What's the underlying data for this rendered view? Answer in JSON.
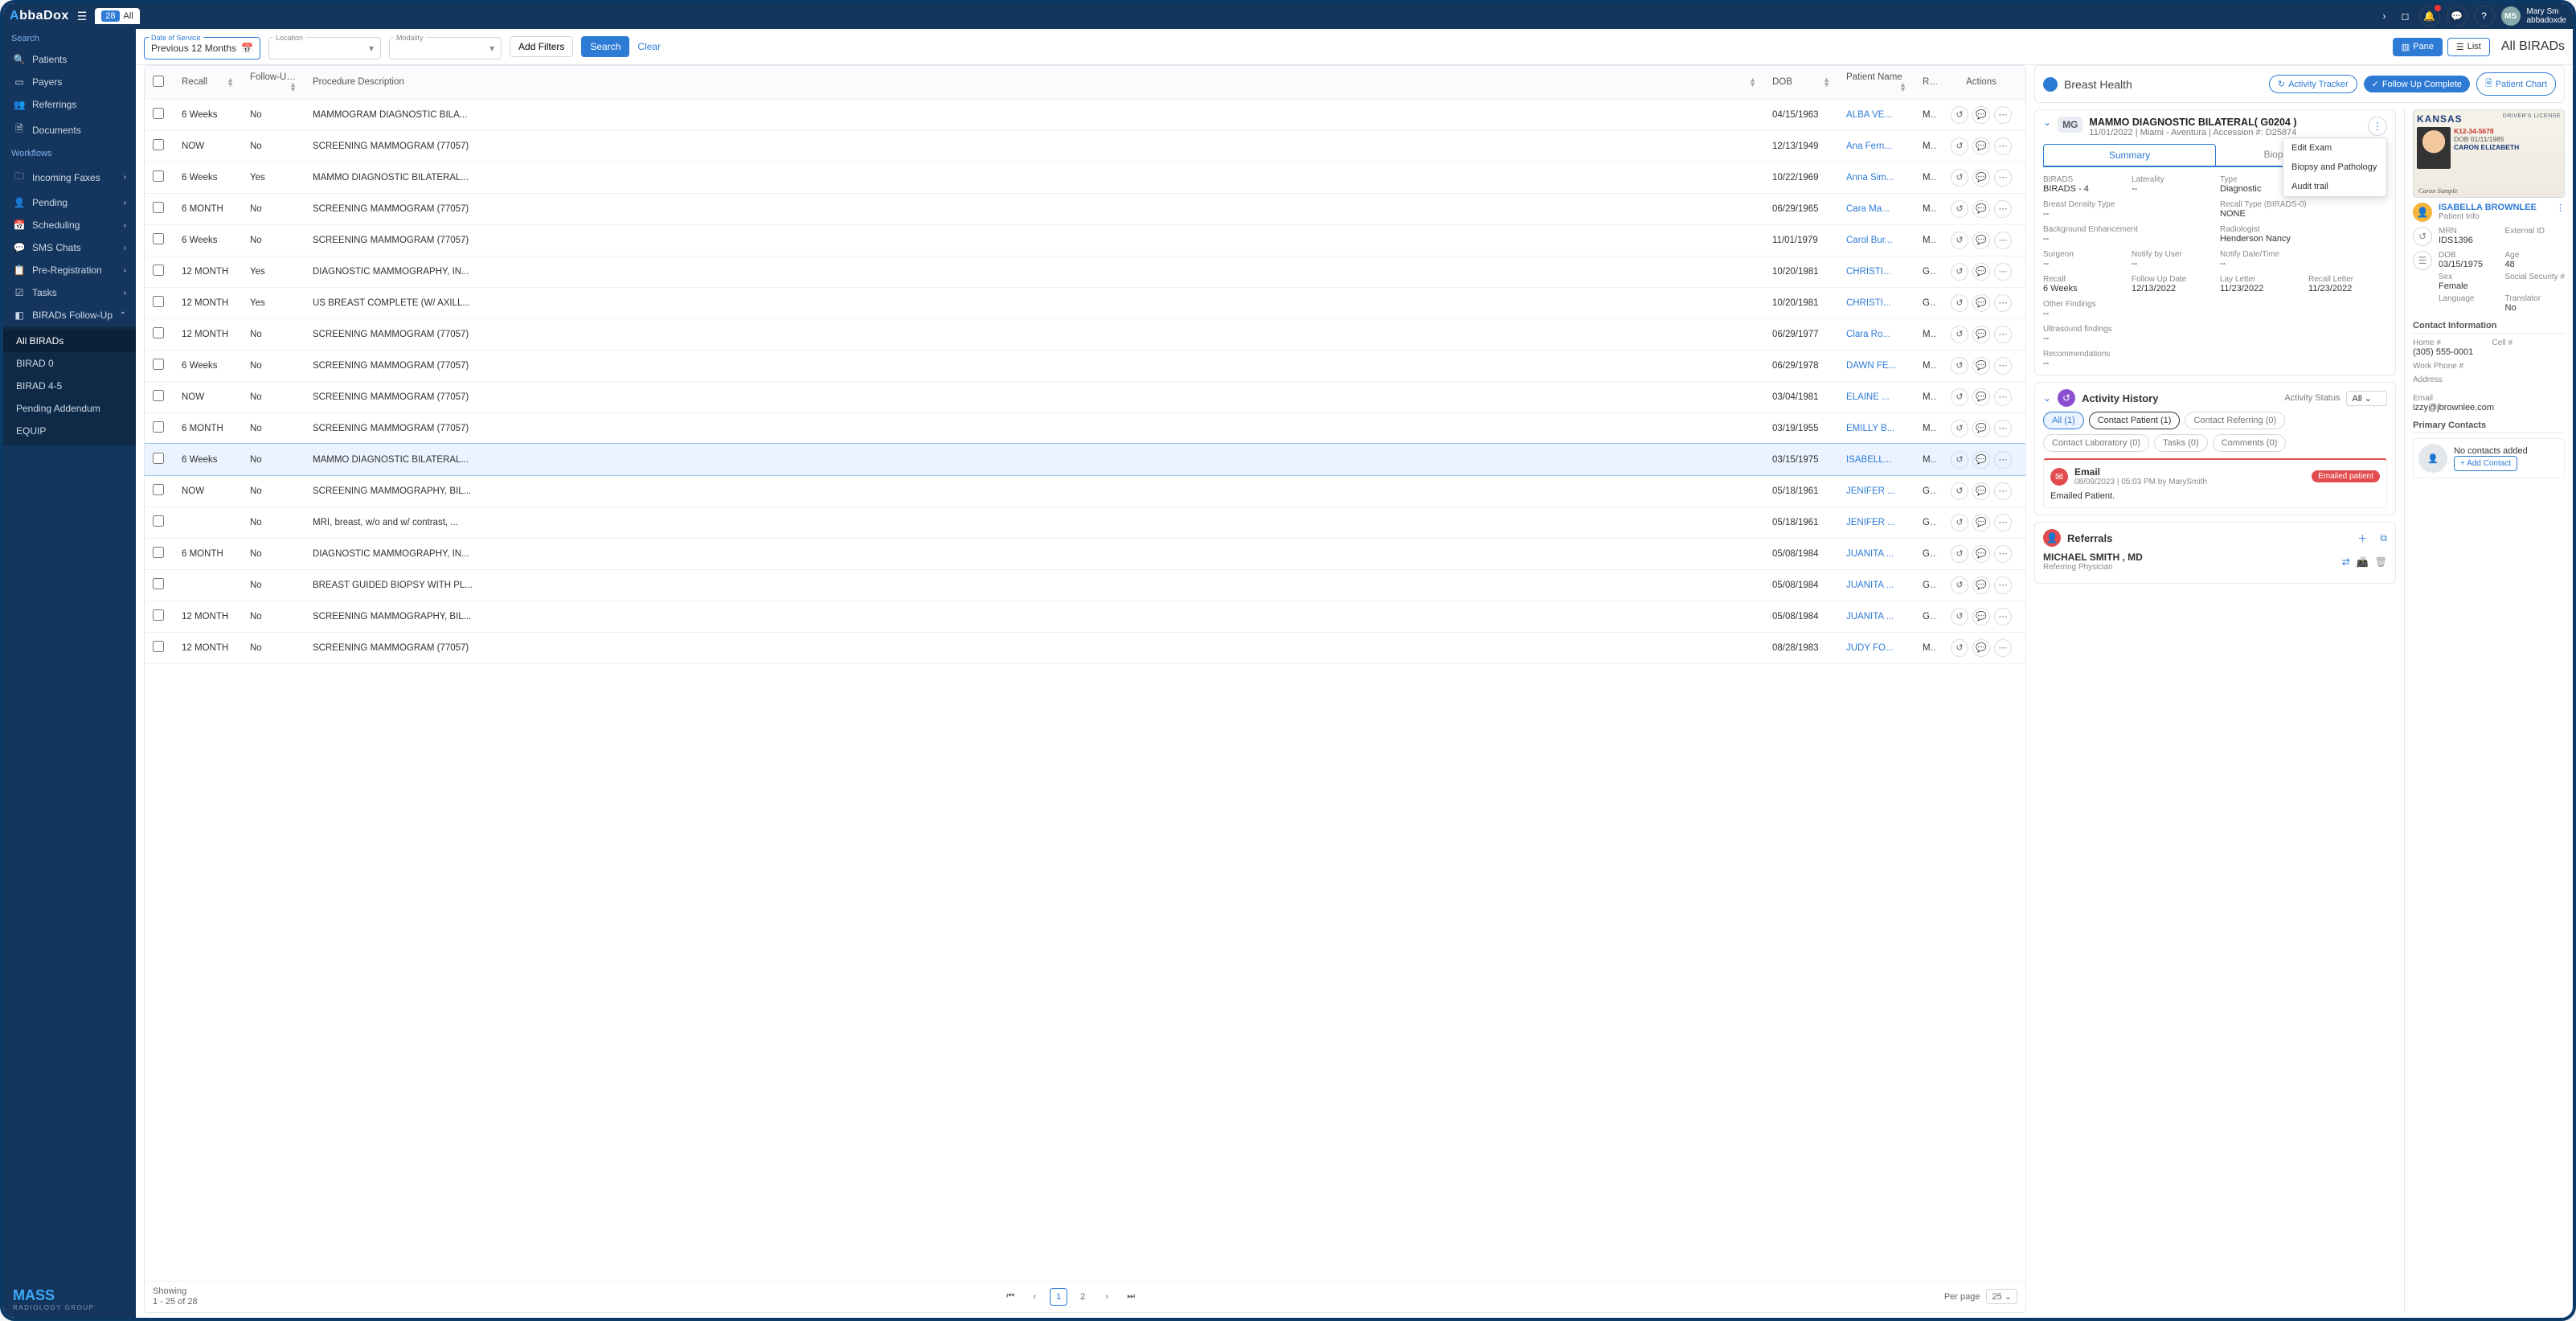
{
  "topbar": {
    "logo_a": "A",
    "logo_rest": "bbaDox",
    "tab_count": "28",
    "tab_all": "All",
    "user_initials": "MS",
    "user_name": "Mary Sm",
    "user_sub": "abbadoxde"
  },
  "sidebar": {
    "search_head": "Search",
    "items1": [
      "Patients",
      "Payers",
      "Referrings",
      "Documents"
    ],
    "workflow_head": "Workflows",
    "items2": [
      "Incoming Faxes",
      "Pending",
      "Scheduling",
      "SMS Chats",
      "Pre-Registration",
      "Tasks",
      "BIRADs Follow-Up"
    ],
    "sub": [
      "All BIRADs",
      "BIRAD 0",
      "BIRAD 4-5",
      "Pending Addendum",
      "EQUIP"
    ],
    "brand2": "MASS",
    "brand2_sub": "RADIOLOGY GROUP"
  },
  "filters": {
    "dos_label": "Date of Service",
    "dos_value": "Previous 12 Months",
    "loc_label": "Location",
    "mod_label": "Modality",
    "add_filters": "Add Filters",
    "search": "Search",
    "clear": "Clear",
    "pane": "Pane",
    "list": "List",
    "page_title": "All BIRADs"
  },
  "grid": {
    "headers": {
      "recall": "Recall",
      "fup": "Follow-Up Completed?",
      "proc": "Procedure Description",
      "dob": "DOB",
      "name": "Patient Name",
      "r": "R",
      "actions": "Actions"
    },
    "rows": [
      {
        "recall": "6 Weeks",
        "fup": "No",
        "proc": "MAMMOGRAM DIAGNOSTIC BILA...",
        "dob": "04/15/1963",
        "name": "ALBA VE...",
        "r": "M"
      },
      {
        "recall": "NOW",
        "fup": "No",
        "proc": "SCREENING MAMMOGRAM (77057)",
        "dob": "12/13/1949",
        "name": "Ana Fern...",
        "r": "M"
      },
      {
        "recall": "6 Weeks",
        "fup": "Yes",
        "proc": "MAMMO DIAGNOSTIC BILATERAL...",
        "dob": "10/22/1969",
        "name": "Anna Sim...",
        "r": "M"
      },
      {
        "recall": "6 MONTH",
        "fup": "No",
        "proc": "SCREENING MAMMOGRAM (77057)",
        "dob": "06/29/1965",
        "name": "Cara Ma...",
        "r": "M"
      },
      {
        "recall": "6 Weeks",
        "fup": "No",
        "proc": "SCREENING MAMMOGRAM (77057)",
        "dob": "11/01/1979",
        "name": "Carol Bur...",
        "r": "M"
      },
      {
        "recall": "12 MONTH",
        "fup": "Yes",
        "proc": "DIAGNOSTIC MAMMOGRAPHY, IN...",
        "dob": "10/20/1981",
        "name": "CHRISTI...",
        "r": "G"
      },
      {
        "recall": "12 MONTH",
        "fup": "Yes",
        "proc": "US BREAST COMPLETE (W/ AXILL...",
        "dob": "10/20/1981",
        "name": "CHRISTI...",
        "r": "G"
      },
      {
        "recall": "12 MONTH",
        "fup": "No",
        "proc": "SCREENING MAMMOGRAM (77057)",
        "dob": "06/29/1977",
        "name": "Clara Ro...",
        "r": "M"
      },
      {
        "recall": "6 Weeks",
        "fup": "No",
        "proc": "SCREENING MAMMOGRAM (77057)",
        "dob": "06/29/1978",
        "name": "DAWN FE...",
        "r": "M"
      },
      {
        "recall": "NOW",
        "fup": "No",
        "proc": "SCREENING MAMMOGRAM (77057)",
        "dob": "03/04/1981",
        "name": "ELAINE ...",
        "r": "M"
      },
      {
        "recall": "6 MONTH",
        "fup": "No",
        "proc": "SCREENING MAMMOGRAM (77057)",
        "dob": "03/19/1955",
        "name": "EMILLY B...",
        "r": "M"
      },
      {
        "recall": "6 Weeks",
        "fup": "No",
        "proc": "MAMMO DIAGNOSTIC BILATERAL...",
        "dob": "03/15/1975",
        "name": "ISABELL...",
        "r": "M",
        "selected": true
      },
      {
        "recall": "NOW",
        "fup": "No",
        "proc": "SCREENING MAMMOGRAPHY, BIL...",
        "dob": "05/18/1961",
        "name": "JENIFER ...",
        "r": "G"
      },
      {
        "recall": "",
        "fup": "No",
        "proc": "MRI, breast, w/o and w/ contrast, ...",
        "dob": "05/18/1961",
        "name": "JENIFER ...",
        "r": "G"
      },
      {
        "recall": "6 MONTH",
        "fup": "No",
        "proc": "DIAGNOSTIC MAMMOGRAPHY, IN...",
        "dob": "05/08/1984",
        "name": "JUANITA ...",
        "r": "G"
      },
      {
        "recall": "",
        "fup": "No",
        "proc": "BREAST GUIDED BIOPSY WITH PL...",
        "dob": "05/08/1984",
        "name": "JUANITA ...",
        "r": "G"
      },
      {
        "recall": "12 MONTH",
        "fup": "No",
        "proc": "SCREENING MAMMOGRAPHY, BIL...",
        "dob": "05/08/1984",
        "name": "JUANITA ...",
        "r": "G"
      },
      {
        "recall": "12 MONTH",
        "fup": "No",
        "proc": "SCREENING MAMMOGRAM (77057)",
        "dob": "08/28/1983",
        "name": "JUDY FO...",
        "r": "M"
      }
    ],
    "pager": {
      "showing_l1": "Showing",
      "showing_l2": "1 - 25 of 28",
      "p1": "1",
      "p2": "2",
      "per_page_lbl": "Per page",
      "per_page_val": "25"
    }
  },
  "breast_health": {
    "title": "Breast Health",
    "activity_tracker": "Activity Tracker",
    "followup_complete": "Follow Up Complete",
    "patient_chart": "Patient Chart"
  },
  "exam": {
    "mod": "MG",
    "title": "MAMMO DIAGNOSTIC BILATERAL( G0204 )",
    "date": "11/01/2022",
    "loc": "Miami - Aventura",
    "acc_lbl": "Accession #:",
    "acc": "D25874",
    "tabs": {
      "summary": "Summary",
      "biopsies": "Biopsies & Pathol"
    },
    "menu": {
      "edit": "Edit Exam",
      "biopsy": "Biopsy and Pathology",
      "audit": "Audit trail"
    },
    "fields": {
      "birads_lbl": "BIRADS",
      "birads_val": "BIRADS - 4",
      "lat_lbl": "Laterality",
      "lat_val": "--",
      "type_lbl": "Type",
      "type_val": "Diagnostic",
      "dens_lbl": "Breast Density Type",
      "dens_val": "--",
      "recallt_lbl": "Recall Type (BIRADS-0)",
      "recallt_val": "NONE",
      "bgenh_lbl": "Background Enhancement",
      "bgenh_val": "--",
      "rad_lbl": "Radiologist",
      "rad_val": "Henderson Nancy",
      "surg_lbl": "Surgeon",
      "surg_val": "--",
      "nbu_lbl": "Notify by User",
      "nbu_val": "--",
      "ndt_lbl": "Notify Date/Time",
      "ndt_val": "--",
      "recall_lbl": "Recall",
      "recall_val": "6 Weeks",
      "fud_lbl": "Follow Up Date",
      "fud_val": "12/13/2022",
      "lay_lbl": "Lay Letter",
      "lay_val": "11/23/2022",
      "rl_lbl": "Recall Letter",
      "rl_val": "11/23/2022",
      "of_lbl": "Other Findings",
      "of_val": "--",
      "us_lbl": "Ultrasound findings",
      "us_val": "--",
      "rec_lbl": "Recommendations",
      "rec_val": "--"
    }
  },
  "activity": {
    "title": "Activity History",
    "status_lbl": "Activity Status",
    "status_val": "All",
    "chips": {
      "all": "All (1)",
      "cp": "Contact Patient (1)",
      "cr": "Contact Referring (0)",
      "cl": "Contact Laboratory (0)",
      "tk": "Tasks (0)",
      "cm": "Comments (0)"
    },
    "item": {
      "type": "Email",
      "meta": "08/09/2023 | 05:03 PM by MarySmith",
      "badge": "Emailed patient",
      "body": "Emailed Patient."
    }
  },
  "referrals": {
    "title": "Referrals",
    "name": "MICHAEL SMITH , MD",
    "role": "Referring Physician"
  },
  "patient": {
    "dl_state": "KANSAS",
    "dl_type": "DRIVER'S LICENSE",
    "dl_num": "K12-34-5678",
    "dl_name": "CARON ELIZABETH",
    "dl_dob_lbl": "DOB",
    "dl_dob": "01/11/1985",
    "dl_sample": "Caron Sample",
    "name": "ISABELLA BROWNLEE",
    "sub": "Patient Info",
    "mrn_lbl": "MRN",
    "mrn": "IDS1396",
    "ext_lbl": "External ID",
    "dob_lbl": "DOB",
    "dob": "03/15/1975",
    "age_lbl": "Age",
    "age": "48",
    "sex_lbl": "Sex",
    "sex": "Female",
    "ssn_lbl": "Social Security #",
    "lang_lbl": "Language",
    "trans_lbl": "Translator",
    "trans": "No",
    "contact_head": "Contact Information",
    "home_lbl": "Home #",
    "home": "(305) 555-0001",
    "cell_lbl": "Cell #",
    "work_lbl": "Work Phone #",
    "addr_lbl": "Address",
    "email_lbl": "Email",
    "email": "izzy@jbrownlee.com",
    "pc_head": "Primary Contacts",
    "nc_text": "No contacts added",
    "add_contact": "+ Add Contact"
  }
}
